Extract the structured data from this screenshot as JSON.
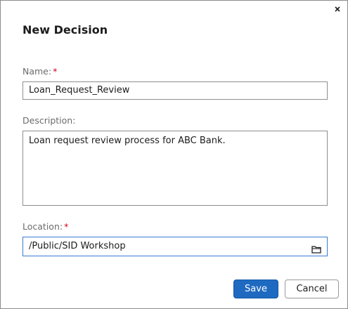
{
  "dialog": {
    "title": "New Decision"
  },
  "fields": {
    "name": {
      "label": "Name:",
      "required_mark": "*",
      "value": "Loan_Request_Review"
    },
    "description": {
      "label": "Description:",
      "value": "Loan request review process for ABC Bank."
    },
    "location": {
      "label": "Location:",
      "required_mark": "*",
      "value": "/Public/SID Workshop",
      "icon": "folder-icon"
    }
  },
  "buttons": {
    "save_label": "Save",
    "cancel_label": "Cancel"
  },
  "icons": {
    "close": "close-icon"
  },
  "colors": {
    "primary": "#1f6ac1",
    "required": "#d0021b",
    "focus_border": "#3a7bd5"
  }
}
